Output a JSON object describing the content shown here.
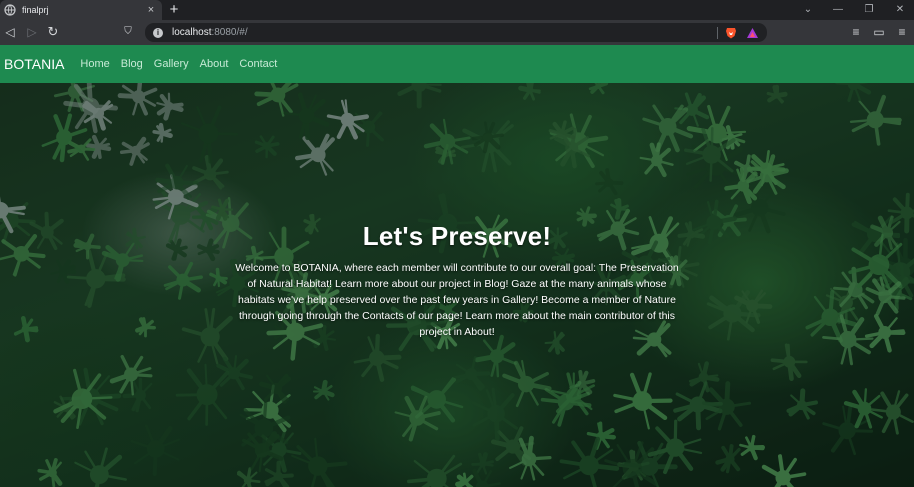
{
  "browser": {
    "tab": {
      "title": "finalprj",
      "close": "×"
    },
    "new_tab": "+",
    "window_controls": {
      "dropdown": "⌄",
      "minimize": "—",
      "restore": "❐",
      "close": "✕"
    },
    "nav": {
      "back": "◁",
      "forward": "▷",
      "reload": "↻",
      "bookmark": "⛉"
    },
    "address": {
      "host": "localhost",
      "path": ":8080/#/"
    },
    "toolbar_right": {
      "playlist": "≡",
      "wallet": "▭",
      "menu": "≡"
    },
    "icons": [
      "globe-icon",
      "info-icon",
      "brave-shields-icon",
      "brave-rewards-icon"
    ]
  },
  "navbar": {
    "brand": "BOTANIA",
    "links": [
      "Home",
      "Blog",
      "Gallery",
      "About",
      "Contact"
    ],
    "background": "#1e8a50"
  },
  "hero": {
    "title": "Let's Preserve!",
    "lines": [
      "Welcome to BOTANIA, where each member will contribute to our overall goal: The Preservation",
      "of Natural Habitat! Learn more about our project in Blog! Gaze at the many animals whose",
      "habitats we've help preserved over the past few years in Gallery! Become a member of Nature",
      "through going through the Contacts of our page! Learn more about the main contributor of this",
      "project in About!"
    ]
  }
}
